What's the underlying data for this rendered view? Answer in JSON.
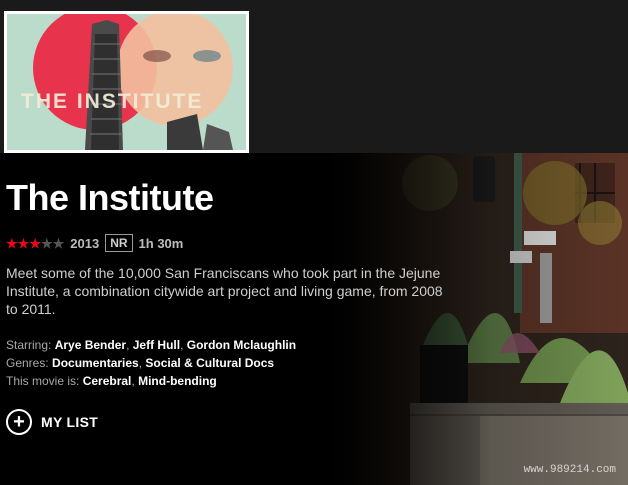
{
  "poster": {
    "title_text": "THE INSTITUTE"
  },
  "movie": {
    "title": "The Institute",
    "stars_filled": 3,
    "stars_total": 5,
    "year": "2013",
    "maturity_rating": "NR",
    "duration": "1h 30m",
    "synopsis": "Meet some of the 10,000 San Franciscans who took part in the Jejune Institute, a combination citywide art project and living game, from 2008 to 2011.",
    "starring_label": "Starring:",
    "starring": [
      "Arye Bender",
      "Jeff Hull",
      "Gordon Mclaughlin"
    ],
    "genres_label": "Genres:",
    "genres": [
      "Documentaries",
      "Social & Cultural Docs"
    ],
    "this_movie_is_label": "This movie is:",
    "this_movie_is": [
      "Cerebral",
      "Mind-bending"
    ]
  },
  "actions": {
    "my_list_label": "MY LIST",
    "my_list_icon": "plus-circle-icon"
  },
  "watermark": {
    "text": "www.989214.com"
  },
  "colors": {
    "accent_red": "#e50914",
    "background": "#000000"
  }
}
